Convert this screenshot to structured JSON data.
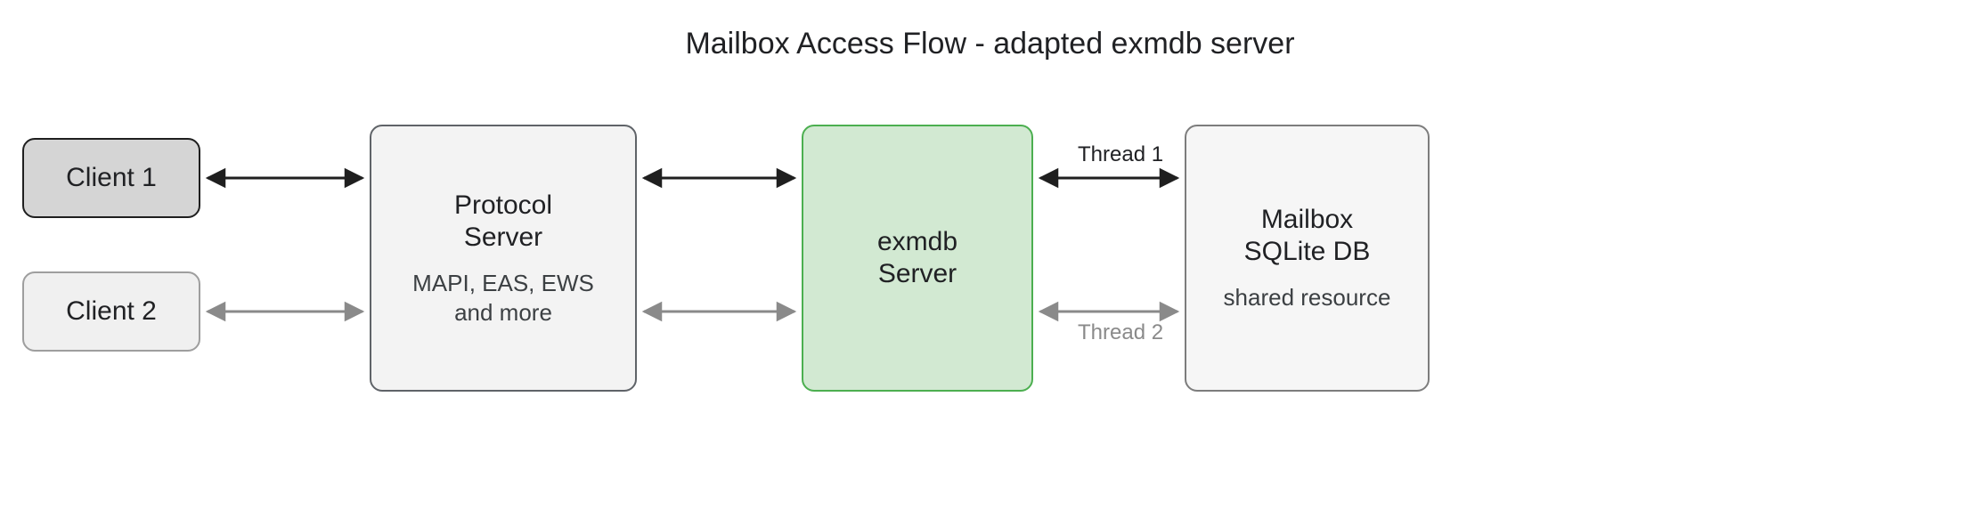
{
  "title": "Mailbox Access Flow - adapted exmdb server",
  "nodes": {
    "client1": {
      "label": "Client 1"
    },
    "client2": {
      "label": "Client 2"
    },
    "protocol": {
      "line1": "Protocol",
      "line2": "Server",
      "sub1": "MAPI, EAS, EWS",
      "sub2": "and more"
    },
    "exmdb": {
      "line1": "exmdb",
      "line2": "Server"
    },
    "mailbox": {
      "line1": "Mailbox",
      "line2": "SQLite DB",
      "sub1": "shared resource"
    }
  },
  "edges": {
    "thread1_label": "Thread 1",
    "thread2_label": "Thread 2"
  },
  "colors": {
    "accent_green": "#4caf50",
    "inactive_gray": "#8a8a8a",
    "stroke_dark": "#1f1f1f"
  }
}
